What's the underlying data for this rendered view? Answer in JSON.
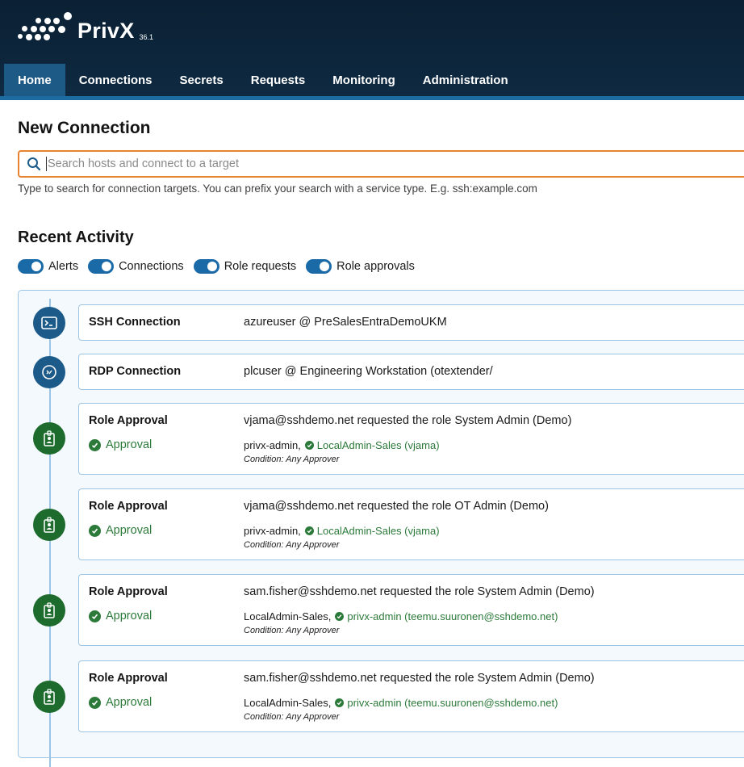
{
  "brand": {
    "name": "PrivX",
    "version": "36.1"
  },
  "nav": {
    "items": [
      {
        "label": "Home",
        "active": true
      },
      {
        "label": "Connections",
        "active": false
      },
      {
        "label": "Secrets",
        "active": false
      },
      {
        "label": "Requests",
        "active": false
      },
      {
        "label": "Monitoring",
        "active": false
      },
      {
        "label": "Administration",
        "active": false
      }
    ]
  },
  "new_connection": {
    "title": "New Connection",
    "search_placeholder": "Search hosts and connect to a target",
    "help": "Type to search for connection targets. You can prefix your search with a service type. E.g. ssh:example.com"
  },
  "recent_activity": {
    "title": "Recent Activity",
    "filters": [
      {
        "label": "Alerts",
        "on": true
      },
      {
        "label": "Connections",
        "on": true
      },
      {
        "label": "Role requests",
        "on": true
      },
      {
        "label": "Role approvals",
        "on": true
      }
    ],
    "items": [
      {
        "type": "SSH Connection",
        "icon": "terminal-icon",
        "desc": "azureuser @ PreSalesEntraDemoUKM"
      },
      {
        "type": "RDP Connection",
        "icon": "remote-desktop-icon",
        "desc": "plcuser @ Engineering Workstation (otextender/"
      },
      {
        "type": "Role Approval",
        "icon": "badge-icon",
        "desc": "vjama@sshdemo.net requested the role System Admin (Demo)",
        "status": "Approval",
        "approver_pending": "privx-admin,",
        "approver_ok": "LocalAdmin-Sales (vjama)",
        "condition": "Condition: Any Approver"
      },
      {
        "type": "Role Approval",
        "icon": "badge-icon",
        "desc": "vjama@sshdemo.net requested the role OT Admin (Demo)",
        "status": "Approval",
        "approver_pending": "privx-admin,",
        "approver_ok": "LocalAdmin-Sales (vjama)",
        "condition": "Condition: Any Approver"
      },
      {
        "type": "Role Approval",
        "icon": "badge-icon",
        "desc": "sam.fisher@sshdemo.net requested the role System Admin (Demo)",
        "status": "Approval",
        "approver_pending": "LocalAdmin-Sales,",
        "approver_ok": "privx-admin (teemu.suuronen@sshdemo.net)",
        "condition": "Condition: Any Approver"
      },
      {
        "type": "Role Approval",
        "icon": "badge-icon",
        "desc": "sam.fisher@sshdemo.net requested the role System Admin (Demo)",
        "status": "Approval",
        "approver_pending": "LocalAdmin-Sales,",
        "approver_ok": "privx-admin (teemu.suuronen@sshdemo.net)",
        "condition": "Condition: Any Approver"
      }
    ]
  },
  "colors": {
    "header": "#0e2a42",
    "nav_active": "#1d5a86",
    "accent_orange": "#e8822e",
    "toggle": "#1b6aa8",
    "success": "#2c7a3a"
  }
}
